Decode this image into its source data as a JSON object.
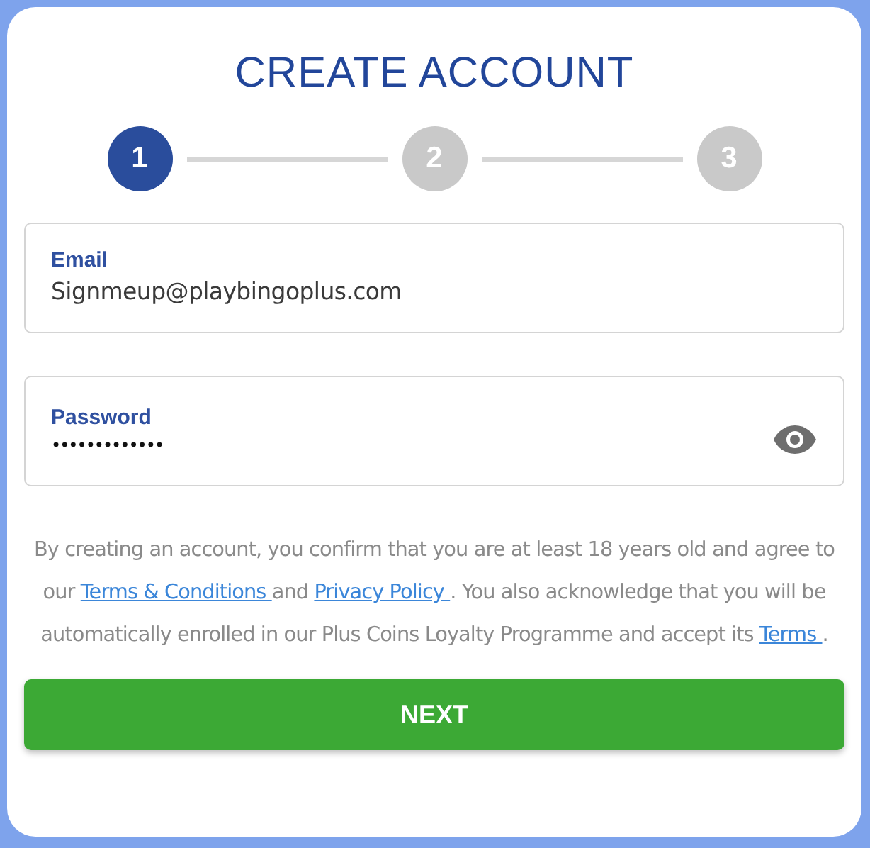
{
  "title": "CREATE ACCOUNT",
  "steps": [
    {
      "label": "1",
      "selected": true
    },
    {
      "label": "2",
      "selected": false
    },
    {
      "label": "3",
      "selected": false
    }
  ],
  "fields": [
    {
      "kind": "text",
      "label": "Email",
      "value": "Signmeup@playbingoplus.com"
    },
    {
      "kind": "password",
      "label": "Password",
      "value": "•••••••••••••"
    }
  ],
  "consent": [
    {
      "kind": "text",
      "text": "By creating an account, you confirm that you are at least 18 years old and agree to our "
    },
    {
      "kind": "link",
      "text": "Terms & Conditions "
    },
    {
      "kind": "text",
      "text": "and "
    },
    {
      "kind": "link",
      "text": "Privacy Policy "
    },
    {
      "kind": "text",
      "text": ". You also acknowledge that you will be automatically enrolled in our Plus Coins Loyalty Programme and accept its "
    },
    {
      "kind": "link",
      "text": "Terms "
    },
    {
      "kind": "text",
      "text": "."
    }
  ],
  "button": "NEXT"
}
